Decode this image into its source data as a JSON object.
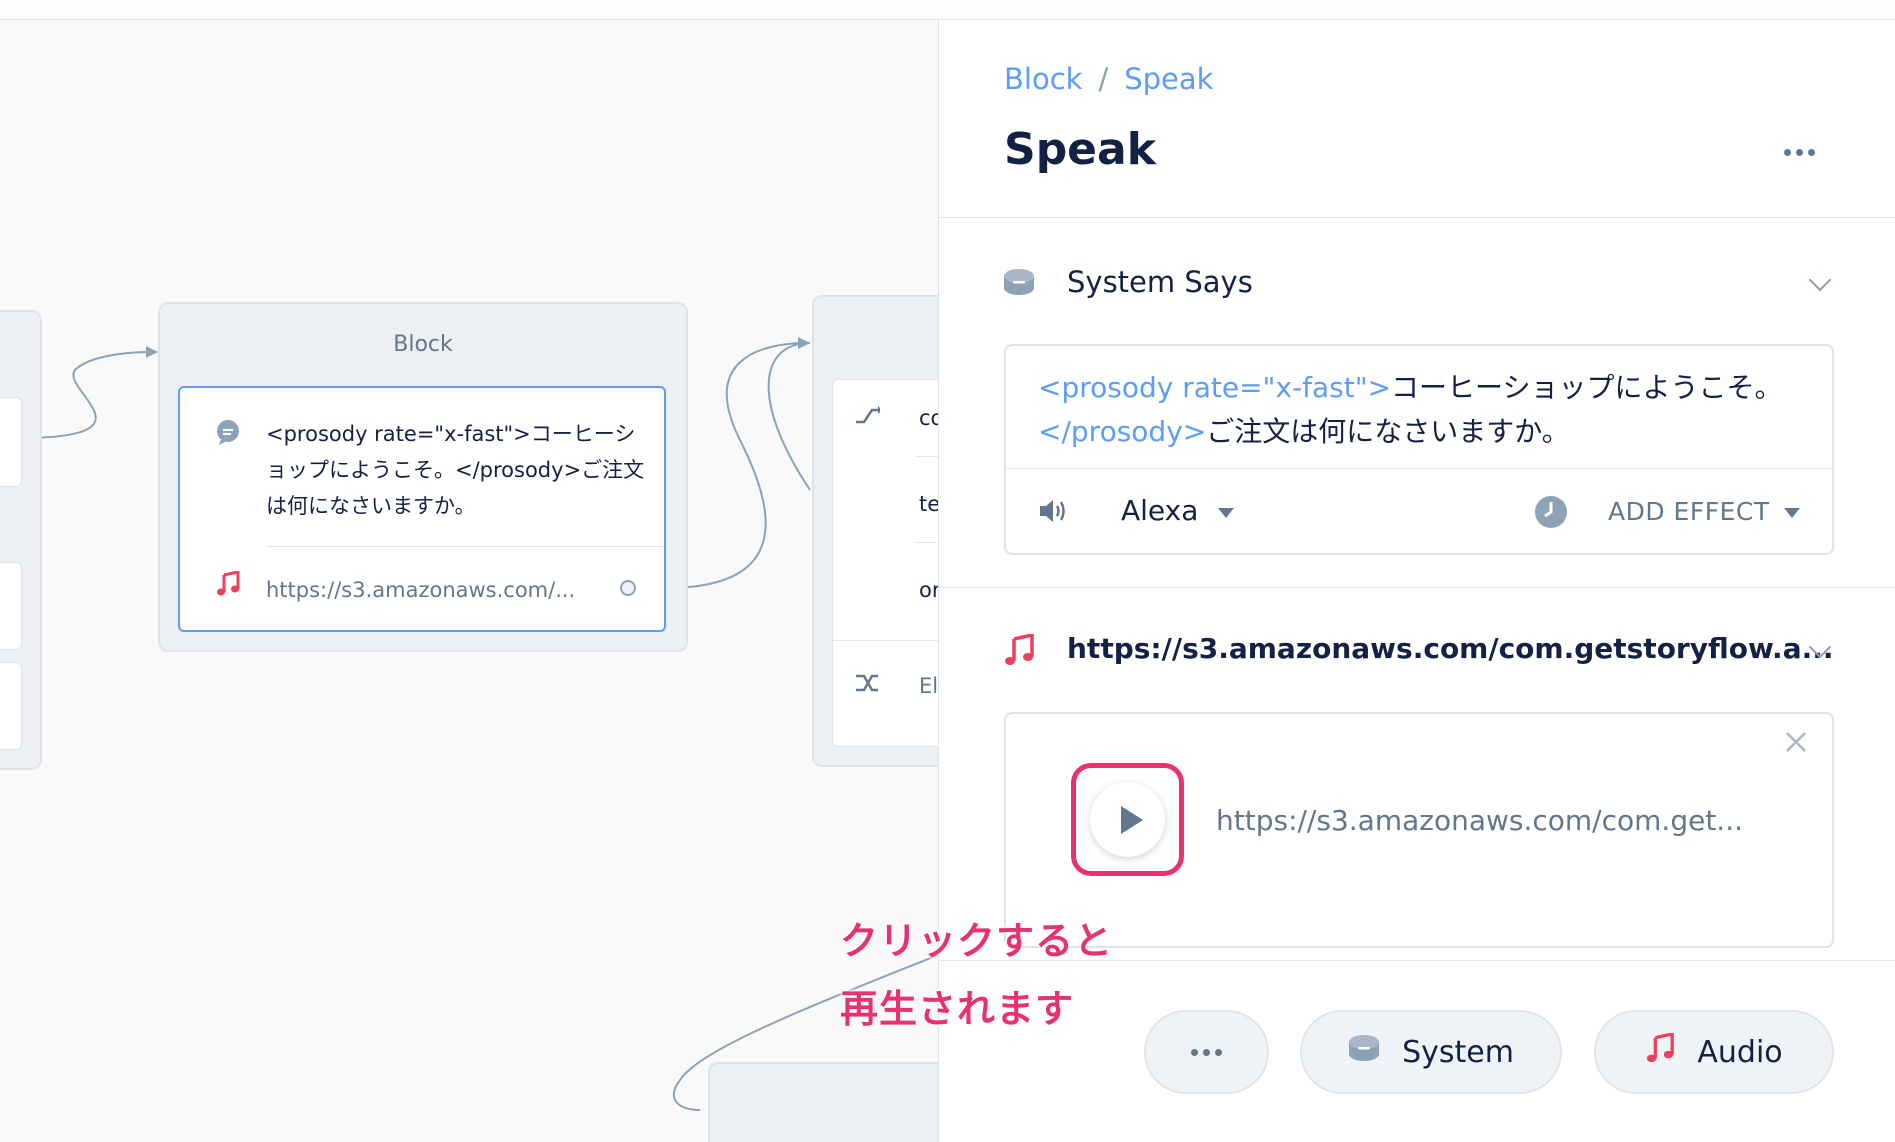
{
  "canvas": {
    "block1": {
      "title": "Block",
      "speak_text": "<prosody rate=\"x-fast\">コーヒーショップにようこそ。</prosody>ご注文は何になさいますか。",
      "audio_url": "https://s3.amazonaws.com/..."
    },
    "block2": {
      "rows": [
        "co",
        "te",
        "or",
        "El"
      ]
    }
  },
  "annotation": {
    "line1": "クリックすると",
    "line2": "再生されます"
  },
  "panel": {
    "breadcrumb": {
      "parent": "Block",
      "separator": "/",
      "current": "Speak"
    },
    "title": "Speak",
    "system_says": {
      "title": "System Says",
      "prosody_open": "<prosody rate=\"x-fast\">",
      "text1": "コーヒーショップにようこそ。",
      "prosody_close": "</prosody>",
      "text2": "ご注文は何になさいますか。",
      "voice": "Alexa",
      "add_effect": "ADD EFFECT"
    },
    "audio": {
      "title": "https://s3.amazonaws.com/com.getstoryflow.a...",
      "url": "https://s3.amazonaws.com/com.get..."
    },
    "footer": {
      "system_label": "System",
      "audio_label": "Audio"
    }
  },
  "colors": {
    "accent": "#5d9df5",
    "highlight": "#e8326f",
    "audio_icon": "#f03e5f"
  }
}
